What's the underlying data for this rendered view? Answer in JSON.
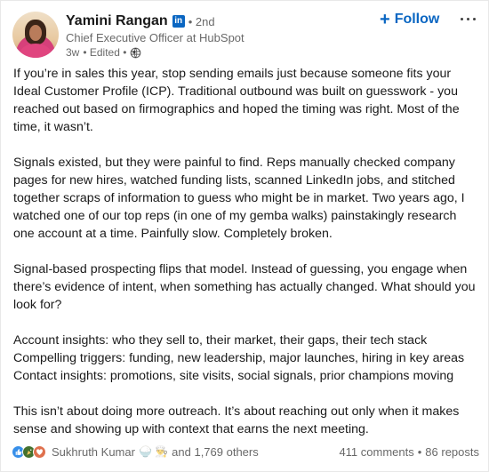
{
  "post": {
    "author": {
      "name": "Yamini Rangan",
      "badge": "in",
      "degree": "• 2nd",
      "headline": "Chief Executive Officer at HubSpot",
      "time": "3w",
      "edited": "• Edited •",
      "visibility_icon": "globe-icon"
    },
    "follow_label": "Follow",
    "follow_icon": "+",
    "more_icon": "ellipsis-icon",
    "paragraphs": [
      "If you’re in sales this year, stop sending emails just because someone fits your Ideal Customer Profile (ICP). Traditional outbound was built on guesswork - you reached out based on firmographics and hoped the timing was right. Most of the time, it wasn’t.",
      "Signals existed, but they were painful to find. Reps manually checked company pages for new hires, watched funding lists, scanned LinkedIn jobs, and stitched together scraps of information to guess who might be in market. Two years ago, I watched one of our top reps (in one of my gemba walks) painstakingly research one account at a time. Painfully slow. Completely broken.",
      "Signal-based prospecting flips that model. Instead of guessing, you engage when there’s evidence of intent, when something has actually changed. What should you look for?",
      "Account insights: who they sell to, their market, their gaps, their tech stack\nCompelling triggers: funding, new leadership, major launches, hiring in key areas\nContact insights: promotions, site visits, social signals, prior champions moving",
      "This isn’t about doing more outreach. It’s about reaching out only when it makes sense and showing up with context that earns the next meeting."
    ],
    "social": {
      "reactions": [
        "like",
        "celebrate",
        "love"
      ],
      "reacted_by": "Sukhruth Kumar",
      "emoji": "🍚 👨‍🍳",
      "others": "and 1,769 others",
      "comments": "411 comments",
      "separator": "•",
      "reposts": "86 reposts"
    }
  },
  "colors": {
    "accent": "#0a66c2",
    "like": "#378fe9",
    "celebrate": "#44712e",
    "love": "#df704d"
  }
}
